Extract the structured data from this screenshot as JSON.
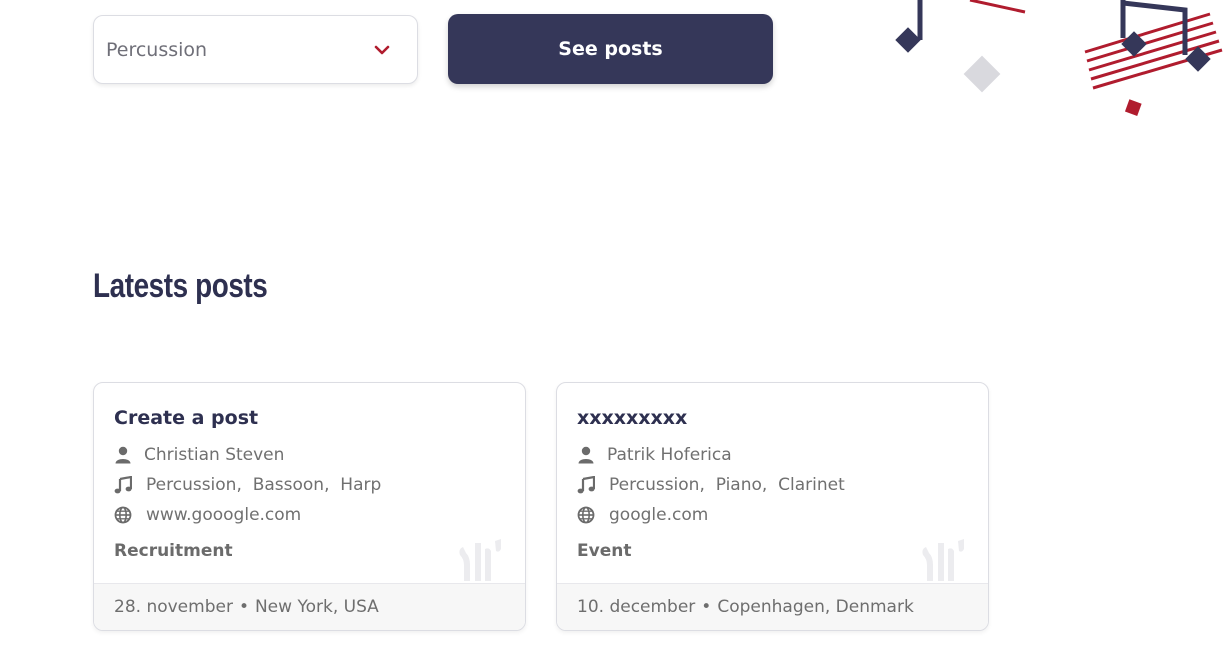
{
  "filter": {
    "instrument_value": "Percussion",
    "chevron_icon": "chevron-down-icon",
    "see_posts_label": "See posts",
    "accent_color": "#b01c2e",
    "button_color": "#353759"
  },
  "section": {
    "title": "Latests posts"
  },
  "posts": [
    {
      "title": "Create a post",
      "author": "Christian Steven",
      "instruments": [
        "Percussion",
        "Bassoon",
        "Harp"
      ],
      "website": "www.gooogle.com",
      "type": "Recruitment",
      "date": "28. november",
      "separator": "•",
      "location": "New York, USA"
    },
    {
      "title": "xxxxxxxxx",
      "author": "Patrik Hoferica",
      "instruments": [
        "Percussion",
        "Piano",
        "Clarinet"
      ],
      "website": "google.com",
      "type": "Event",
      "date": "10. december",
      "separator": "•",
      "location": "Copenhagen, Denmark"
    }
  ],
  "icons": {
    "author": "user-icon",
    "instruments": "music-note-icon",
    "website": "globe-icon"
  }
}
